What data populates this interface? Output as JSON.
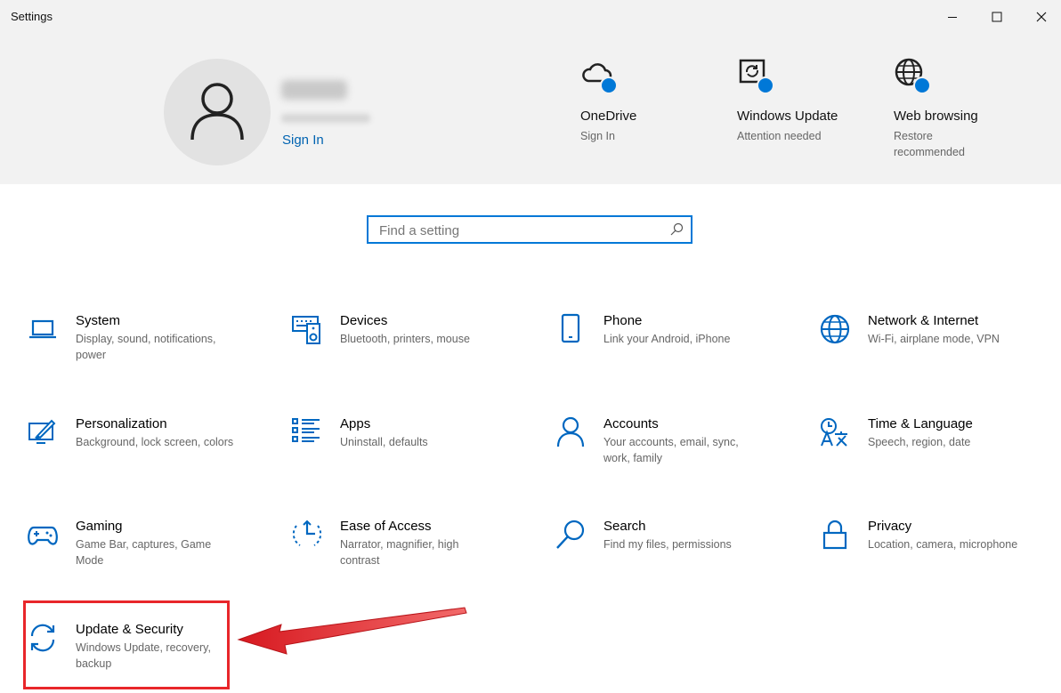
{
  "window": {
    "title": "Settings",
    "minimize_icon": "minimize-icon",
    "maximize_icon": "maximize-icon",
    "close_icon": "close-icon"
  },
  "header": {
    "sign_in": "Sign In",
    "items": [
      {
        "name": "OneDrive",
        "status": "Sign In",
        "icon": "cloud-icon"
      },
      {
        "name": "Windows Update",
        "status": "Attention needed",
        "icon": "sync-icon"
      },
      {
        "name": "Web browsing",
        "status": "Restore recommended",
        "icon": "globe-icon"
      }
    ]
  },
  "search": {
    "placeholder": "Find a setting",
    "icon": "search-icon"
  },
  "tiles": [
    {
      "name": "System",
      "desc": "Display, sound, notifications, power",
      "icon": "laptop-icon"
    },
    {
      "name": "Devices",
      "desc": "Bluetooth, printers, mouse",
      "icon": "devices-icon"
    },
    {
      "name": "Phone",
      "desc": "Link your Android, iPhone",
      "icon": "phone-icon"
    },
    {
      "name": "Network & Internet",
      "desc": "Wi-Fi, airplane mode, VPN",
      "icon": "globe-icon"
    },
    {
      "name": "Personalization",
      "desc": "Background, lock screen, colors",
      "icon": "paintbrush-icon"
    },
    {
      "name": "Apps",
      "desc": "Uninstall, defaults",
      "icon": "apps-list-icon"
    },
    {
      "name": "Accounts",
      "desc": "Your accounts, email, sync, work, family",
      "icon": "person-icon"
    },
    {
      "name": "Time & Language",
      "desc": "Speech, region, date",
      "icon": "time-language-icon"
    },
    {
      "name": "Gaming",
      "desc": "Game Bar, captures, Game Mode",
      "icon": "gamepad-icon"
    },
    {
      "name": "Ease of Access",
      "desc": "Narrator, magnifier, high contrast",
      "icon": "ease-of-access-icon"
    },
    {
      "name": "Search",
      "desc": "Find my files, permissions",
      "icon": "search-icon"
    },
    {
      "name": "Privacy",
      "desc": "Location, camera, microphone",
      "icon": "lock-icon"
    },
    {
      "name": "Update & Security",
      "desc": "Windows Update, recovery, backup",
      "icon": "sync-icon"
    }
  ],
  "colors": {
    "accent": "#0078d7",
    "highlight": "#e8262a",
    "header_bg": "#f2f2f2"
  }
}
